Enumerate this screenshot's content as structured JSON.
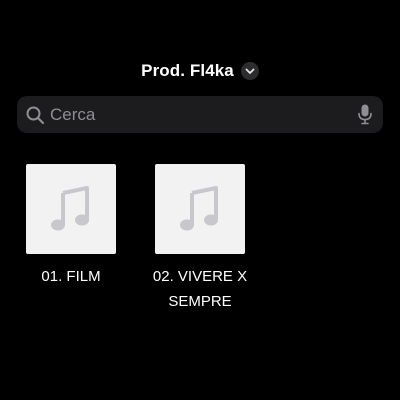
{
  "header": {
    "title": "Prod. Fl4ka",
    "chevron_icon": "chevron-down-icon"
  },
  "search": {
    "placeholder": "Cerca",
    "value": "",
    "search_icon": "magnifying-glass-icon",
    "mic_icon": "microphone-icon"
  },
  "items": [
    {
      "title": "01. FILM",
      "artwork_icon": "music-note-icon"
    },
    {
      "title": "02. VIVERE X SEMPRE",
      "artwork_icon": "music-note-icon"
    }
  ],
  "colors": {
    "background": "#000000",
    "search_background": "#1c1c1e",
    "placeholder": "#8e8e93",
    "artwork_background": "#f2f2f2",
    "artwork_glyph": "#c7c7cc",
    "chevron_background": "#2c2c2e"
  }
}
